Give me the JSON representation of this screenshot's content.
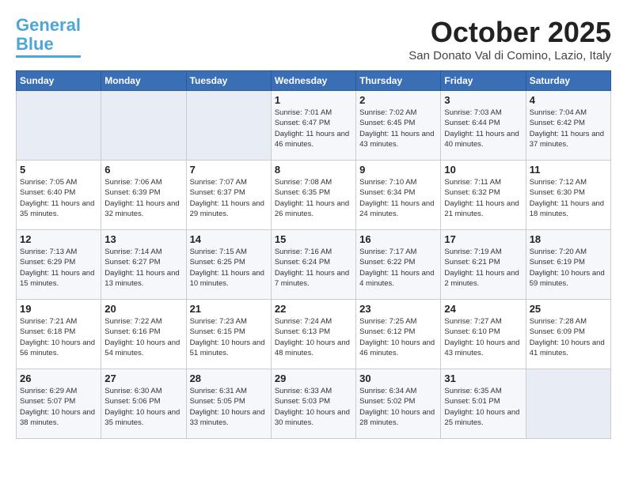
{
  "header": {
    "logo_line1": "General",
    "logo_line2": "Blue",
    "month": "October 2025",
    "location": "San Donato Val di Comino, Lazio, Italy"
  },
  "weekdays": [
    "Sunday",
    "Monday",
    "Tuesday",
    "Wednesday",
    "Thursday",
    "Friday",
    "Saturday"
  ],
  "weeks": [
    [
      {
        "day": null,
        "sunrise": "",
        "sunset": "",
        "daylight": ""
      },
      {
        "day": null,
        "sunrise": "",
        "sunset": "",
        "daylight": ""
      },
      {
        "day": null,
        "sunrise": "",
        "sunset": "",
        "daylight": ""
      },
      {
        "day": "1",
        "sunrise": "7:01 AM",
        "sunset": "6:47 PM",
        "daylight": "11 hours and 46 minutes."
      },
      {
        "day": "2",
        "sunrise": "7:02 AM",
        "sunset": "6:45 PM",
        "daylight": "11 hours and 43 minutes."
      },
      {
        "day": "3",
        "sunrise": "7:03 AM",
        "sunset": "6:44 PM",
        "daylight": "11 hours and 40 minutes."
      },
      {
        "day": "4",
        "sunrise": "7:04 AM",
        "sunset": "6:42 PM",
        "daylight": "11 hours and 37 minutes."
      }
    ],
    [
      {
        "day": "5",
        "sunrise": "7:05 AM",
        "sunset": "6:40 PM",
        "daylight": "11 hours and 35 minutes."
      },
      {
        "day": "6",
        "sunrise": "7:06 AM",
        "sunset": "6:39 PM",
        "daylight": "11 hours and 32 minutes."
      },
      {
        "day": "7",
        "sunrise": "7:07 AM",
        "sunset": "6:37 PM",
        "daylight": "11 hours and 29 minutes."
      },
      {
        "day": "8",
        "sunrise": "7:08 AM",
        "sunset": "6:35 PM",
        "daylight": "11 hours and 26 minutes."
      },
      {
        "day": "9",
        "sunrise": "7:10 AM",
        "sunset": "6:34 PM",
        "daylight": "11 hours and 24 minutes."
      },
      {
        "day": "10",
        "sunrise": "7:11 AM",
        "sunset": "6:32 PM",
        "daylight": "11 hours and 21 minutes."
      },
      {
        "day": "11",
        "sunrise": "7:12 AM",
        "sunset": "6:30 PM",
        "daylight": "11 hours and 18 minutes."
      }
    ],
    [
      {
        "day": "12",
        "sunrise": "7:13 AM",
        "sunset": "6:29 PM",
        "daylight": "11 hours and 15 minutes."
      },
      {
        "day": "13",
        "sunrise": "7:14 AM",
        "sunset": "6:27 PM",
        "daylight": "11 hours and 13 minutes."
      },
      {
        "day": "14",
        "sunrise": "7:15 AM",
        "sunset": "6:25 PM",
        "daylight": "11 hours and 10 minutes."
      },
      {
        "day": "15",
        "sunrise": "7:16 AM",
        "sunset": "6:24 PM",
        "daylight": "11 hours and 7 minutes."
      },
      {
        "day": "16",
        "sunrise": "7:17 AM",
        "sunset": "6:22 PM",
        "daylight": "11 hours and 4 minutes."
      },
      {
        "day": "17",
        "sunrise": "7:19 AM",
        "sunset": "6:21 PM",
        "daylight": "11 hours and 2 minutes."
      },
      {
        "day": "18",
        "sunrise": "7:20 AM",
        "sunset": "6:19 PM",
        "daylight": "10 hours and 59 minutes."
      }
    ],
    [
      {
        "day": "19",
        "sunrise": "7:21 AM",
        "sunset": "6:18 PM",
        "daylight": "10 hours and 56 minutes."
      },
      {
        "day": "20",
        "sunrise": "7:22 AM",
        "sunset": "6:16 PM",
        "daylight": "10 hours and 54 minutes."
      },
      {
        "day": "21",
        "sunrise": "7:23 AM",
        "sunset": "6:15 PM",
        "daylight": "10 hours and 51 minutes."
      },
      {
        "day": "22",
        "sunrise": "7:24 AM",
        "sunset": "6:13 PM",
        "daylight": "10 hours and 48 minutes."
      },
      {
        "day": "23",
        "sunrise": "7:25 AM",
        "sunset": "6:12 PM",
        "daylight": "10 hours and 46 minutes."
      },
      {
        "day": "24",
        "sunrise": "7:27 AM",
        "sunset": "6:10 PM",
        "daylight": "10 hours and 43 minutes."
      },
      {
        "day": "25",
        "sunrise": "7:28 AM",
        "sunset": "6:09 PM",
        "daylight": "10 hours and 41 minutes."
      }
    ],
    [
      {
        "day": "26",
        "sunrise": "6:29 AM",
        "sunset": "5:07 PM",
        "daylight": "10 hours and 38 minutes."
      },
      {
        "day": "27",
        "sunrise": "6:30 AM",
        "sunset": "5:06 PM",
        "daylight": "10 hours and 35 minutes."
      },
      {
        "day": "28",
        "sunrise": "6:31 AM",
        "sunset": "5:05 PM",
        "daylight": "10 hours and 33 minutes."
      },
      {
        "day": "29",
        "sunrise": "6:33 AM",
        "sunset": "5:03 PM",
        "daylight": "10 hours and 30 minutes."
      },
      {
        "day": "30",
        "sunrise": "6:34 AM",
        "sunset": "5:02 PM",
        "daylight": "10 hours and 28 minutes."
      },
      {
        "day": "31",
        "sunrise": "6:35 AM",
        "sunset": "5:01 PM",
        "daylight": "10 hours and 25 minutes."
      },
      {
        "day": null,
        "sunrise": "",
        "sunset": "",
        "daylight": ""
      }
    ]
  ]
}
